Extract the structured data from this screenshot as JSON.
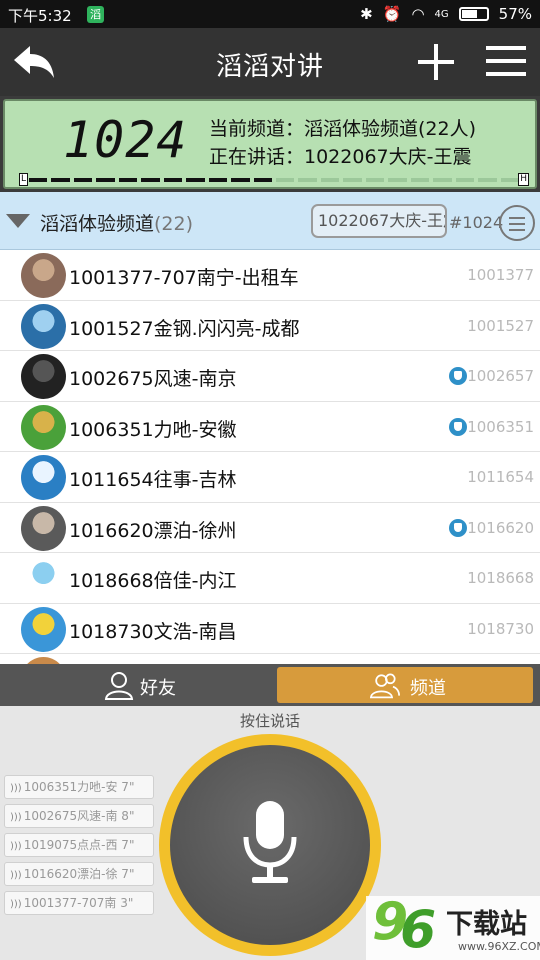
{
  "status_bar": {
    "time": "下午5:32",
    "app_icon_label": "滔",
    "network": "4G",
    "battery": "57%"
  },
  "title_bar": {
    "title": "滔滔对讲"
  },
  "lcd": {
    "channel_number": "1024",
    "current_channel_label": "当前频道：滔滔体验频道(22人)",
    "speaking_label": "正在讲话：1022067大庆-王震",
    "low_marker": "L",
    "high_marker": "H",
    "level": 0.5
  },
  "channel": {
    "name": "滔滔体验频道",
    "count": "(22)",
    "current_speaker": "1022067大庆-王震",
    "number": "#1024"
  },
  "members": [
    {
      "name": "1001377-707南宁-出租车",
      "id": "1001377",
      "badge": false
    },
    {
      "name": "1001527金钢.闪闪亮-成都",
      "id": "1001527",
      "badge": false
    },
    {
      "name": "1002675风速-南京",
      "id": "1002657",
      "badge": true
    },
    {
      "name": "1006351力吔-安徽",
      "id": "1006351",
      "badge": true
    },
    {
      "name": "1011654往事-吉林",
      "id": "1011654",
      "badge": false
    },
    {
      "name": "1016620漂泊-徐州",
      "id": "1016620",
      "badge": true
    },
    {
      "name": "1018668倍佳-内江",
      "id": "1018668",
      "badge": false
    },
    {
      "name": "1018730文浩-南昌",
      "id": "1018730",
      "badge": false
    }
  ],
  "tabs": {
    "friends": "好友",
    "channel": "频道"
  },
  "talk": {
    "hint": "按住说话",
    "history": [
      "1006351力吔-安 7\"",
      "1002675风速-南 8\"",
      "1019075点点-西 7\"",
      "1016620漂泊-徐 7\"",
      "1001377-707南 3\""
    ]
  },
  "watermark": {
    "digit_a": "9",
    "digit_b": "6",
    "text": "下载站",
    "url": "www.96XZ.COM"
  },
  "colors": {
    "accent_tab": "#d79b3c",
    "ptt_ring": "#f2c02a",
    "lcd_bg": "#b7e0b2",
    "channel_header_bg": "#cde6f7"
  }
}
